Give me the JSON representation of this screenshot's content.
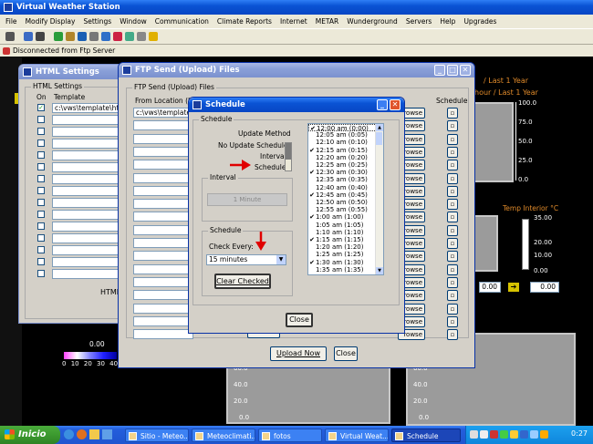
{
  "main_window": {
    "title": "Virtual Weather Station",
    "menu": [
      "File",
      "Modify Display",
      "Settings",
      "Window",
      "Communication",
      "Climate Reports",
      "Internet",
      "METAR",
      "Wunderground",
      "Servers",
      "Help",
      "Upgrades"
    ],
    "status": "Disconnected from Ftp Server"
  },
  "background_labels": {
    "last_year": "/ Last 1 Year",
    "last_year2": "hour / Last 1 Year",
    "temp_interior": "Temp Interior °C",
    "value_zero": "0.00",
    "color_scale_value": "0.00",
    "color_scale_ticks": [
      "0",
      "10",
      "20",
      "30",
      "40"
    ],
    "gauge1_ticks": [
      "100.0",
      "75.0",
      "50.0",
      "25.0",
      "0.0"
    ],
    "gauge2_ticks": [
      "35.00",
      "20.00",
      "10.00",
      "0.00"
    ],
    "gauge2_readout": "0.00",
    "lower_ticks": [
      "60.0",
      "40.0",
      "20.0",
      "0.0"
    ],
    "lower_ticks2": [
      "60.0",
      "40.0",
      "20.0",
      "0.0"
    ]
  },
  "html_settings": {
    "title": "HTML Settings",
    "group_label": "HTML Settings",
    "col_on": "On",
    "col_template": "Template",
    "row1_template": "c:\\vws\\template\\htbi",
    "footer_label": "HTML"
  },
  "ftp_send": {
    "title": "FTP Send (Upload) Files",
    "group_label": "FTP Send (Upload) Files",
    "col_from": "From Location (Loc",
    "col_schedule": "Schedule",
    "row1_from": "c:\\vws\\template\\m",
    "browse_label": "rowse",
    "upload_now": "Upload Now",
    "close": "Close"
  },
  "schedule": {
    "title": "Schedule",
    "group_label": "Schedule",
    "update_method": "Update Method",
    "no_update": "No Update Scheduled",
    "interval_opt": "Interval",
    "schedule_opt": "Schedule",
    "interval_group": "Interval",
    "interval_value": "1 Minute",
    "schedule_group": "Schedule",
    "check_every": "Check Every:",
    "check_every_value": "15 minutes",
    "clear_checked": "Clear Checked",
    "close": "Close",
    "times": [
      {
        "label": "12:00 am (0:00)",
        "checked": true
      },
      {
        "label": "12:05 am (0:05)",
        "checked": false
      },
      {
        "label": "12:10 am (0:10)",
        "checked": false
      },
      {
        "label": "12:15 am (0:15)",
        "checked": true
      },
      {
        "label": "12:20 am (0:20)",
        "checked": false
      },
      {
        "label": "12:25 am (0:25)",
        "checked": false
      },
      {
        "label": "12:30 am (0:30)",
        "checked": true
      },
      {
        "label": "12:35 am (0:35)",
        "checked": false
      },
      {
        "label": "12:40 am (0:40)",
        "checked": false
      },
      {
        "label": "12:45 am (0:45)",
        "checked": true
      },
      {
        "label": "12:50 am (0:50)",
        "checked": false
      },
      {
        "label": "12:55 am (0:55)",
        "checked": false
      },
      {
        "label": "1:00 am (1:00)",
        "checked": true
      },
      {
        "label": "1:05 am (1:05)",
        "checked": false
      },
      {
        "label": "1:10 am (1:10)",
        "checked": false
      },
      {
        "label": "1:15 am (1:15)",
        "checked": true
      },
      {
        "label": "1:20 am (1:20)",
        "checked": false
      },
      {
        "label": "1:25 am (1:25)",
        "checked": false
      },
      {
        "label": "1:30 am (1:30)",
        "checked": true
      },
      {
        "label": "1:35 am (1:35)",
        "checked": false
      }
    ]
  },
  "taskbar": {
    "start": "Inicio",
    "tasks": [
      "Sitio - Meteo...",
      "Meteoclimati...",
      "fotos",
      "Virtual Weat...",
      "Schedule"
    ],
    "clock": "0:27"
  },
  "colors": {
    "accent": "#0a53d4",
    "arrow": "#e00000",
    "start": "#3c9a2f"
  }
}
